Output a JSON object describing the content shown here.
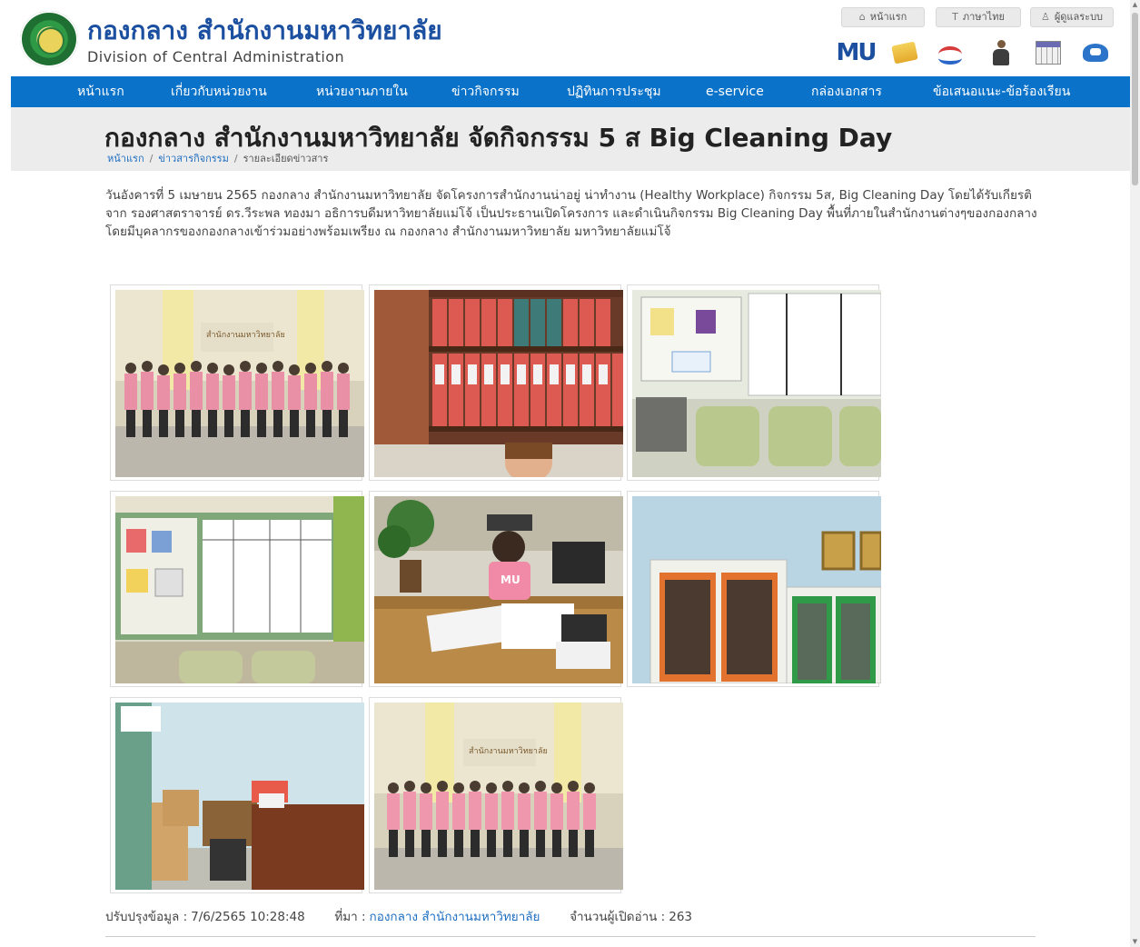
{
  "header": {
    "title": "กองกลาง สำนักงานมหาวิทยาลัย",
    "subtitle": "Division of Central Administration",
    "top_links": [
      {
        "label": "หน้าแรก",
        "icon": "home-icon"
      },
      {
        "label": "ภาษาไทย",
        "icon": "text-icon"
      },
      {
        "label": "ผู้ดูแลระบบ",
        "icon": "user-icon"
      }
    ],
    "quick_icons": [
      "mu-logo-icon",
      "folder-icon",
      "globe-icon",
      "person-icon",
      "calendar-icon",
      "phone-icon"
    ],
    "mu_logo_text": "MU"
  },
  "nav": {
    "items": [
      "หน้าแรก",
      "เกี่ยวกับหน่วยงาน",
      "หน่วยงานภายใน",
      "ข่าวกิจกรรม",
      "ปฏิทินการประชุม",
      "e-service",
      "กล่องเอกสาร",
      "ข้อเสนอแนะ-ข้อร้องเรียน"
    ]
  },
  "article": {
    "title": "กองกลาง สำนักงานมหาวิทยาลัย จัดกิจกรรม 5 ส Big Cleaning Day",
    "breadcrumb": [
      "หน้าแรก",
      "ข่าวสารกิจกรรม",
      "รายละเอียดข่าวสาร"
    ],
    "body": "วันอังคารที่ 5 เมษายน 2565 กองกลาง สำนักงานมหาวิทยาลัย จัดโครงการสำนักงานน่าอยู่ น่าทำงาน (Healthy Workplace) กิจกรรม 5ส, Big Cleaning Day โดยได้รับเกียรติจาก รองศาสตราจารย์ ดร.วีระพล ทองมา อธิการบดีมหาวิทยาลัยแม่โจ้ เป็นประธานเปิดโครงการ และดำเนินกิจกรรม Big Cleaning Day พื้นที่ภายในสำนักงานต่างๆของกองกลาง โดยมีบุคลากรของกองกลางเข้าร่วมอย่างพร้อมเพรียง ณ กองกลาง สำนักงานมหาวิทยาลัย มหาวิทยาลัยแม่โจ้",
    "photo_sign_text": "สำนักงานมหาวิทยาลัย",
    "shirt_text": "MU"
  },
  "meta": {
    "updated_label": "ปรับปรุงข้อมูล :",
    "updated_value": "7/6/2565 10:28:48",
    "source_label": "ที่มา :",
    "source_value": "กองกลาง สำนักงานมหาวิทยาลัย",
    "views_label": "จำนวนผู้เปิดอ่าน :",
    "views_value": "263"
  },
  "colors": {
    "nav": "#0a72c9",
    "title_band": "#ececec",
    "link": "#1f6fc1",
    "brand_title": "#1b4fa0"
  }
}
